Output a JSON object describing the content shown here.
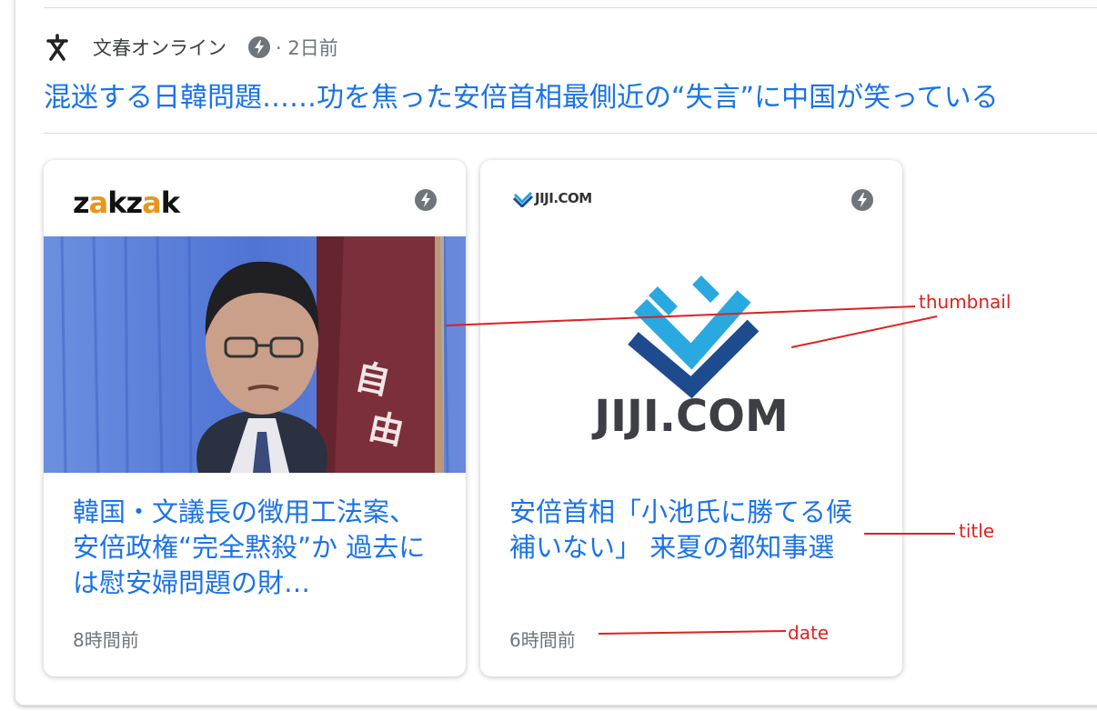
{
  "source": {
    "name": "文春オンライン",
    "meta": "· 2日前",
    "logo_icon": "bunshun-logo-icon",
    "amp_icon": "amp-lightning-icon"
  },
  "headline": "混迷する日韓問題……功を焦った安倍首相最側近の“失言”に中国が笑っている",
  "cards": [
    {
      "publisher_logo_text": [
        "z",
        "a",
        "kz",
        "a",
        "k"
      ],
      "publisher": "zakzak",
      "title": "韓国・文議長の徴用工法案、安倍政権“完全黙殺”か 過去には慰安婦問題の財…",
      "date": "8時間前"
    },
    {
      "publisher_logo_text": "JIJI.COM",
      "publisher": "JIJI.COM",
      "thumbnail_text": "JIJI.COM",
      "title": "安倍首相「小池氏に勝てる候補いない」 来夏の都知事選",
      "date": "6時間前"
    }
  ],
  "annotations": {
    "thumbnail": "thumbnail",
    "title": "title",
    "date": "date"
  },
  "colors": {
    "link": "#1a73e8",
    "annotation": "#e02020",
    "secondary_text": "#70757a"
  }
}
